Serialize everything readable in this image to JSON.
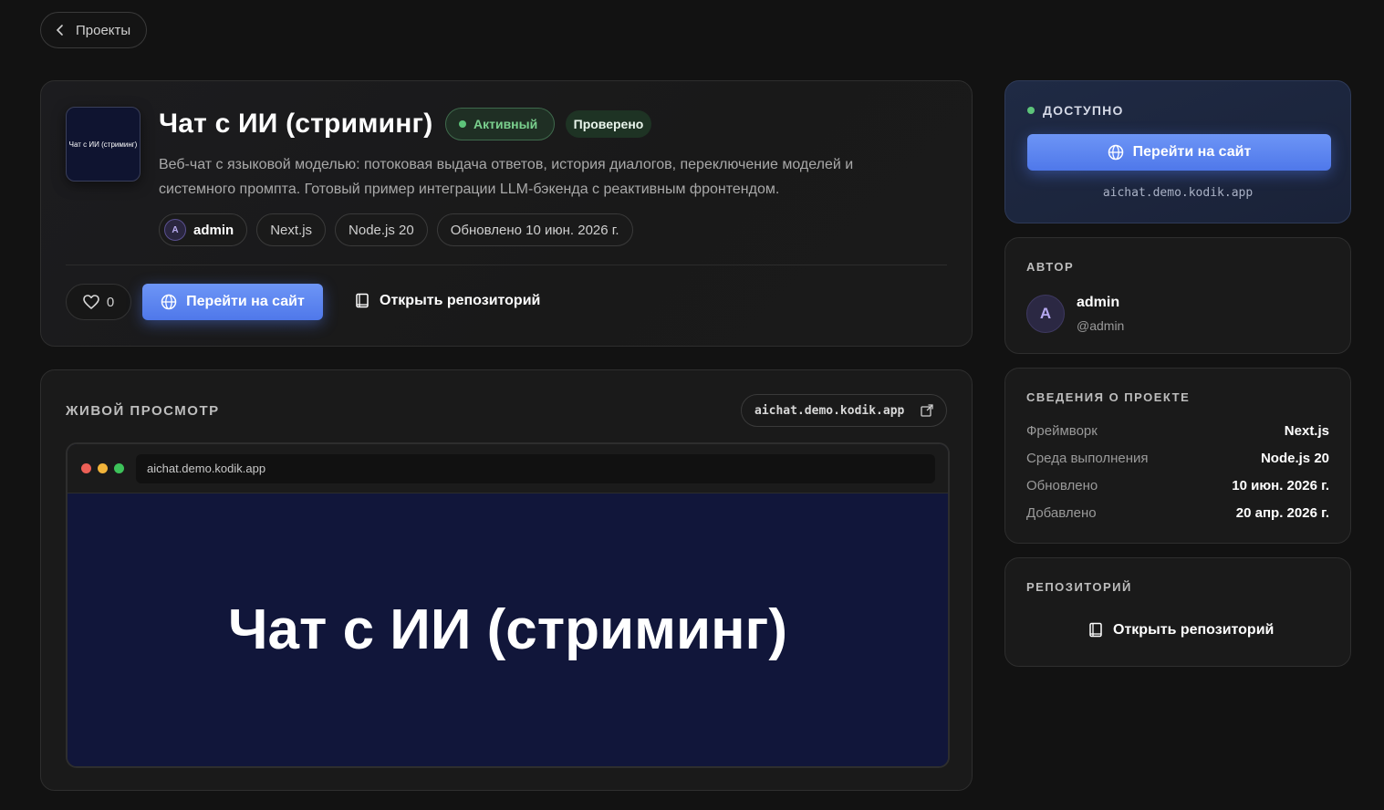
{
  "nav": {
    "back_label": "Проекты"
  },
  "project": {
    "thumb_text": "Чат с ИИ (стриминг)",
    "title": "Чат с ИИ (стриминг)",
    "status_badge": "Активный",
    "verified_badge": "Проверено",
    "description": "Веб-чат с языковой моделью: потоковая выдача ответов, история диалогов, переключение моделей и системного промпта. Готовый пример интеграции LLM-бэкенда с реактивным фронтендом.",
    "author_initial": "A",
    "author": "admin",
    "tags": [
      "Next.js",
      "Node.js 20"
    ],
    "updated_chip": "Обновлено 10 июн. 2026 г.",
    "likes": "0",
    "visit_label": "Перейти на сайт",
    "repo_label": "Открыть репозиторий"
  },
  "preview": {
    "label": "Живой просмотр",
    "url": "aichat.demo.kodik.app",
    "address": "aichat.demo.kodik.app",
    "page_heading": "Чат с ИИ (стриминг)"
  },
  "access": {
    "label": "ДОСТУПНО",
    "visit_label": "Перейти на сайт",
    "url": "aichat.demo.kodik.app"
  },
  "author_card": {
    "label": "Автор",
    "initial": "A",
    "name": "admin",
    "handle": "@admin"
  },
  "info_card": {
    "label": "Сведения о проекте",
    "rows": [
      {
        "key": "Фреймворк",
        "value": "Next.js"
      },
      {
        "key": "Среда выполнения",
        "value": "Node.js 20"
      },
      {
        "key": "Обновлено",
        "value": "10 июн. 2026 г."
      },
      {
        "key": "Добавлено",
        "value": "20 апр. 2026 г."
      }
    ]
  },
  "repo_card": {
    "label": "Репозиторий",
    "link_label": "Открыть репозиторий"
  },
  "colors": {
    "background": "#121212",
    "accent": "#5b83ef",
    "status_green": "#5dc47a"
  }
}
